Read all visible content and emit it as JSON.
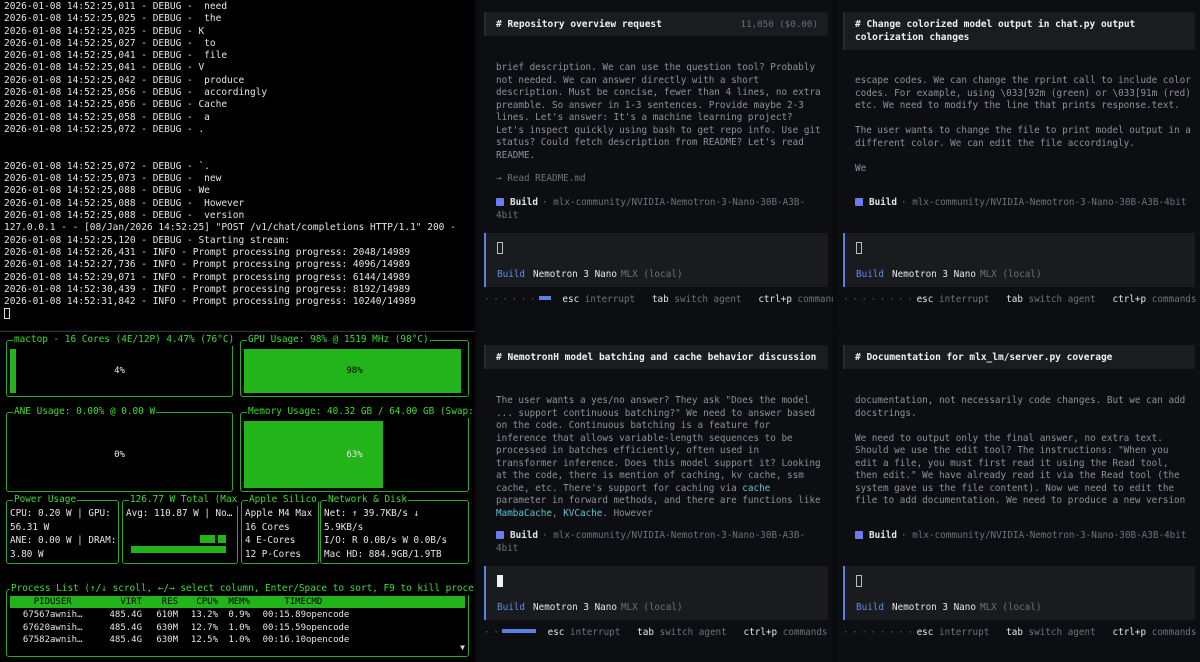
{
  "log": {
    "lines": [
      "2026-01-08 14:52:25,011 - DEBUG -  need",
      "2026-01-08 14:52:25,025 - DEBUG -  the",
      "2026-01-08 14:52:25,025 - DEBUG - K",
      "2026-01-08 14:52:25,027 - DEBUG -  to",
      "2026-01-08 14:52:25,041 - DEBUG -  file",
      "2026-01-08 14:52:25,041 - DEBUG - V",
      "2026-01-08 14:52:25,042 - DEBUG -  produce",
      "2026-01-08 14:52:25,056 - DEBUG -  accordingly",
      "2026-01-08 14:52:25,056 - DEBUG - Cache",
      "2026-01-08 14:52:25,058 - DEBUG -  a",
      "2026-01-08 14:52:25,072 - DEBUG - .",
      "",
      "",
      "2026-01-08 14:52:25,072 - DEBUG - `.",
      "2026-01-08 14:52:25,073 - DEBUG -  new",
      "2026-01-08 14:52:25,088 - DEBUG - We",
      "2026-01-08 14:52:25,088 - DEBUG -  However",
      "2026-01-08 14:52:25,088 - DEBUG -  version",
      "127.0.0.1 - - [08/Jan/2026 14:52:25] \"POST /v1/chat/completions HTTP/1.1\" 200 -",
      "2026-01-08 14:52:25,120 - DEBUG - Starting stream:",
      "2026-01-08 14:52:26,431 - INFO - Prompt processing progress: 2048/14989",
      "2026-01-08 14:52:27,736 - INFO - Prompt processing progress: 4096/14989",
      "2026-01-08 14:52:29,071 - INFO - Prompt processing progress: 6144/14989",
      "2026-01-08 14:52:30,439 - INFO - Prompt processing progress: 8192/14989",
      "2026-01-08 14:52:31,842 - INFO - Prompt processing progress: 10240/14989"
    ]
  },
  "mactop": {
    "cpu": {
      "title": "mactop - 16 Cores (4E/12P) 4.47% (76°C)",
      "value": "4%",
      "level": 0.04
    },
    "gpu": {
      "title": "GPU Usage: 98% @ 1519 MHz (98°C)",
      "value": "98%",
      "level": 0.98
    },
    "ane": {
      "title": "ANE Usage: 0.00% @ 0.00 W",
      "value": "0%",
      "level": 0.0
    },
    "memory": {
      "title": "Memory Usage: 40.32 GB / 64.00 GB (Swap:",
      "value": "63%",
      "level": 0.63
    },
    "power": {
      "title": "Power Usage",
      "lines": [
        "CPU: 0.20 W | GPU:",
        "56.31 W",
        "ANE: 0.00 W | DRAM:",
        "3.80 W"
      ]
    },
    "total": {
      "title": "126.77 W Total (Max",
      "lines": [
        "Avg: 110.87 W | No…"
      ]
    },
    "chip": {
      "title": "Apple Silico",
      "lines": [
        "Apple M4 Max",
        "16 Cores",
        "4 E-Cores",
        "12 P-Cores"
      ]
    },
    "network": {
      "title": "Network & Disk",
      "lines": [
        "Net: ↑ 39.7KB/s ↓",
        "5.9KB/s",
        "I/O: R 0.0B/s W 0.0B/s",
        "Mac HD: 884.9GB/1.9TB"
      ]
    },
    "process": {
      "title": "Process List (↑/↓ scroll, ←/→ select column, Enter/Space to sort, F9 to kill proce",
      "headers": [
        "PID",
        "USER",
        "VIRT",
        "RES",
        "CPU%",
        "MEM%",
        "TIME",
        "CMD"
      ],
      "rows": [
        [
          "67567",
          "awnih…",
          "485.4G",
          "610M",
          "13.2%",
          "0.9%",
          "00:15.89",
          "opencode"
        ],
        [
          "67620",
          "awnih…",
          "485.4G",
          "630M",
          "12.7%",
          "1.0%",
          "00:15.59",
          "opencode"
        ],
        [
          "67582",
          "awnih…",
          "485.4G",
          "630M",
          "12.5%",
          "1.0%",
          "00:16.10",
          "opencode"
        ]
      ],
      "scroll_icon": "▼"
    }
  },
  "panes": [
    {
      "title": "# Repository overview request",
      "tokens": "11,050 ($0.00)",
      "body": "brief description. We can use the question tool? Probably not needed. We can answer directly with a short description. Must be concise, fewer than 4 lines, no extra preamble. So answer in 1-3 sentences. Provide maybe 2-3 lines. Let's answer: It's a machine learning project? Let's inspect quickly using bash to get repo info. Use git status? Could fetch description from README? Let's read README.",
      "tool": "→ Read README.md",
      "build_label": "Build",
      "build_model": "· mlx-community/NVIDIA-Nemotron-3-Nano-30B-A3B-4bit",
      "agent": "Build",
      "model": "Nemotron 3 Nano",
      "provider": "MLX (local)",
      "status": {
        "esc": "esc",
        "interrupt": "interrupt",
        "tab": "tab",
        "switch": "switch agent",
        "ctrl": "ctrl+p",
        "commands": "commands"
      }
    },
    {
      "title": "# Change colorized model output in chat.py output colorization changes",
      "tokens": "",
      "body": "escape codes. We can change the rprint call to include color codes. For example, using \\033[92m (green) or \\033[91m (red) etc. We need to modify the line that prints response.text.\n\nThe user wants to change the file to print model output in a different color. We can edit the file accordingly.\n\nWe",
      "tool": "",
      "build_label": "Build",
      "build_model": "· mlx-community/NVIDIA-Nemotron-3-Nano-30B-A3B-4bit",
      "agent": "Build",
      "model": "Nemotron 3 Nano",
      "provider": "MLX (local)",
      "status": {
        "esc": "esc",
        "interrupt": "interrupt",
        "tab": "tab",
        "switch": "switch agent",
        "ctrl": "ctrl+p",
        "commands": "commands"
      }
    },
    {
      "title": "# NemotronH model batching and cache behavior discussion",
      "tokens": "",
      "body_parts": [
        "The user wants a yes/no answer? They ask \"Does the model ... support continuous batching?\" We need to answer based on the code. Continuous batching is a feature for inference that allows variable-length sequences to be processed in batches efficiently, often used in transformer inference. Does this model support it? Looking at the code, there is mention of caching, kv cache, ssm cache, etc. There's support for caching via ",
        "cache",
        " parameter in forward methods, and there are functions like ",
        "MambaCache",
        ", ",
        "KVCache",
        ". However"
      ],
      "tool": "",
      "build_label": "Build",
      "build_model": "· mlx-community/NVIDIA-Nemotron-3-Nano-30B-A3B-4bit",
      "agent": "Build",
      "model": "Nemotron 3 Nano",
      "provider": "MLX (local)",
      "status": {
        "esc": "esc",
        "interrupt": "interrupt",
        "tab": "tab",
        "switch": "switch agent",
        "ctrl": "ctrl+p",
        "commands": "commands"
      }
    },
    {
      "title": "# Documentation for mlx_lm/server.py coverage",
      "tokens": "",
      "body": "documentation, not necessarily code changes. But we can add docstrings.\n\nWe need to output only the final answer, no extra text. Should we use the edit tool? The instructions: \"When you edit a file, you must first read it using the Read tool, then edit.\" We have already read it via the Read tool (the system gave us the file content). Now we need to edit the file to add documentation. We need to produce a new version",
      "tool": "",
      "build_label": "Build",
      "build_model": "· mlx-community/NVIDIA-Nemotron-3-Nano-30B-A3B-4bit",
      "agent": "Build",
      "model": "Nemotron 3 Nano",
      "provider": "MLX (local)",
      "status": {
        "esc": "esc",
        "interrupt": "interrupt",
        "tab": "tab",
        "switch": "switch agent",
        "ctrl": "ctrl+p",
        "commands": "commands"
      }
    }
  ]
}
